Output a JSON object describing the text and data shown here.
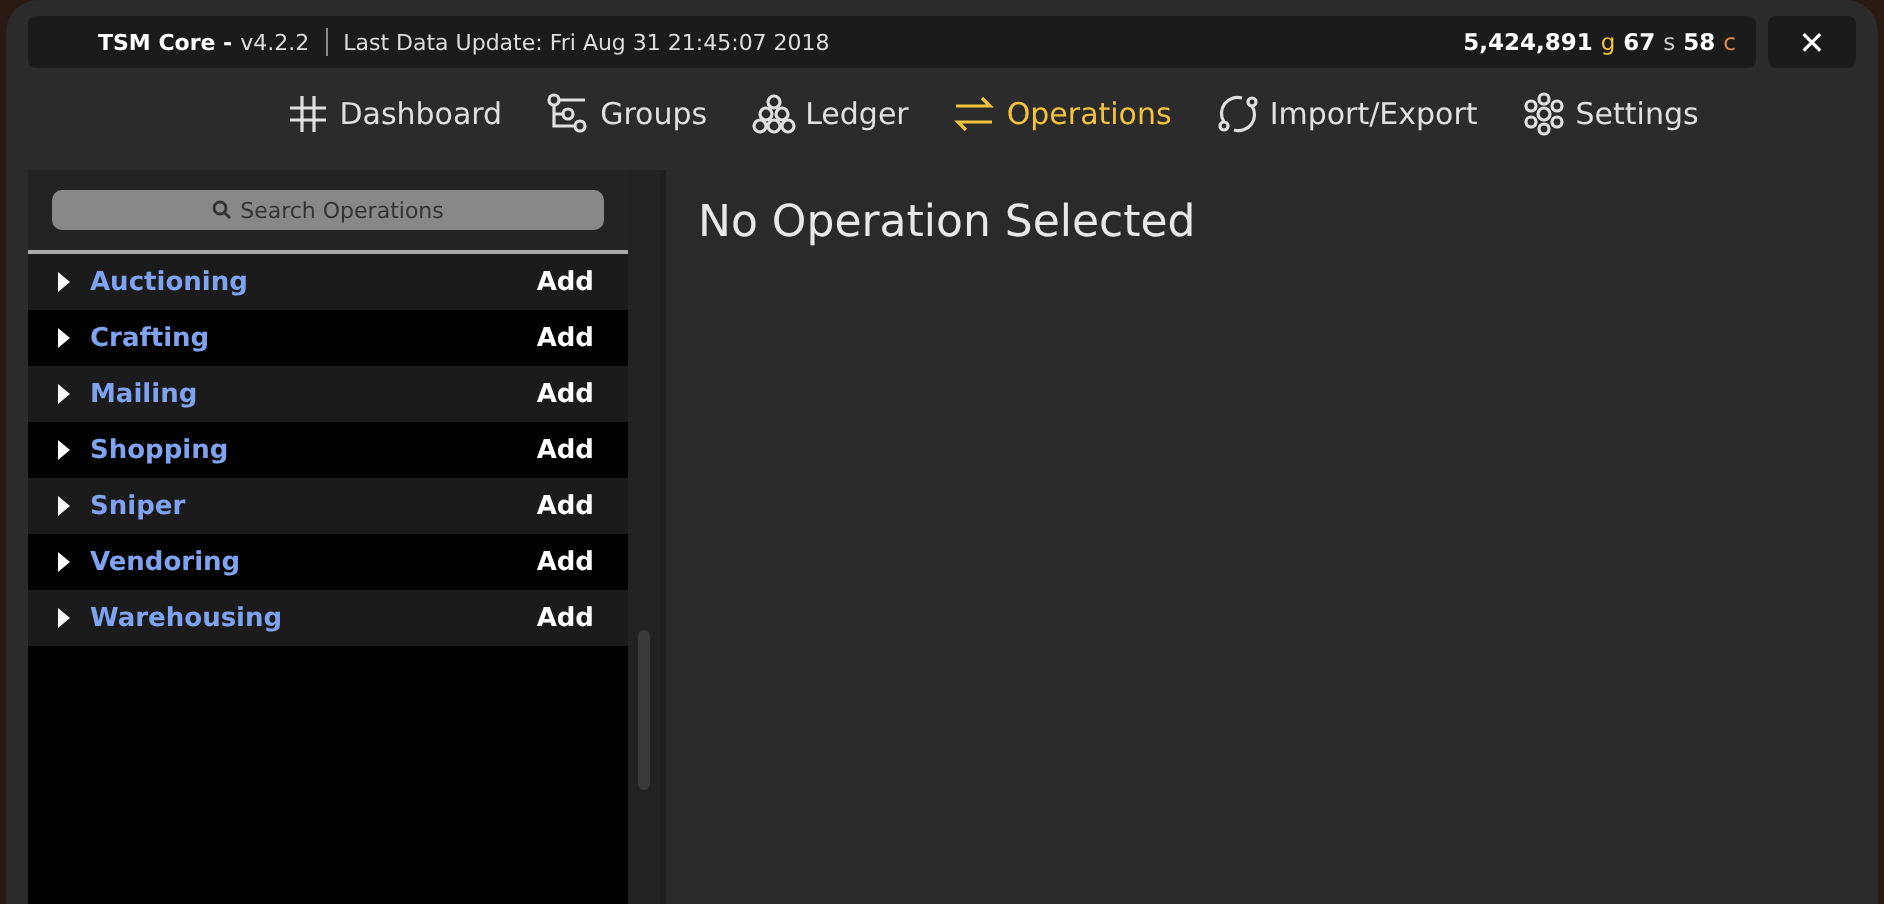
{
  "title_bar": {
    "app_name": "TSM Core -",
    "version": "v4.2.2",
    "last_update": "Last Data Update: Fri Aug 31 21:45:07 2018",
    "money": [
      {
        "kind": "gold",
        "amount": "5,424,891",
        "unit": "g"
      },
      {
        "kind": "silver",
        "amount": "67",
        "unit": "s"
      },
      {
        "kind": "copper",
        "amount": "58",
        "unit": "c"
      }
    ],
    "close": "✕"
  },
  "nav": [
    {
      "kind": "dashboard",
      "label": "Dashboard",
      "selected": false
    },
    {
      "kind": "groups",
      "label": "Groups",
      "selected": false
    },
    {
      "kind": "ledger",
      "label": "Ledger",
      "selected": false
    },
    {
      "kind": "operations",
      "label": "Operations",
      "selected": true
    },
    {
      "kind": "import",
      "label": "Import/Export",
      "selected": false
    },
    {
      "kind": "settings",
      "label": "Settings",
      "selected": false
    }
  ],
  "sidebar": {
    "search": {
      "placeholder": "Search Operations"
    },
    "items": [
      {
        "label": "Auctioning",
        "action": "Add",
        "expanded": false
      },
      {
        "label": "Crafting",
        "action": "Add",
        "expanded": false
      },
      {
        "label": "Mailing",
        "action": "Add",
        "expanded": false
      },
      {
        "label": "Shopping",
        "action": "Add",
        "expanded": false
      },
      {
        "label": "Sniper",
        "action": "Add",
        "expanded": false
      },
      {
        "label": "Vendoring",
        "action": "Add",
        "expanded": false
      },
      {
        "label": "Warehousing",
        "action": "Add",
        "expanded": false
      }
    ]
  },
  "content": {
    "heading": "No Operation Selected"
  }
}
